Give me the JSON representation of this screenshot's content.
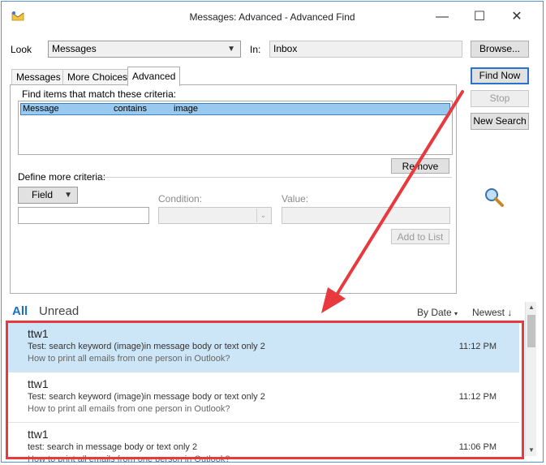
{
  "window": {
    "title": "Messages: Advanced - Advanced Find",
    "minimize_glyph": "—",
    "maximize_glyph": "☐",
    "close_glyph": "✕"
  },
  "look": {
    "label": "Look",
    "value": "Messages",
    "in_label": "In:",
    "in_value": "Inbox",
    "browse_label": "Browse..."
  },
  "actions": {
    "find_now": "Find Now",
    "stop": "Stop",
    "new_search": "New Search"
  },
  "tabs": [
    {
      "label": "Messages"
    },
    {
      "label": "More Choices"
    },
    {
      "label": "Advanced"
    }
  ],
  "advanced": {
    "criteria_heading": "Find items that match these criteria:",
    "criteria": [
      {
        "field": "Message",
        "condition": "contains",
        "value": "image"
      }
    ],
    "remove_label": "Remove",
    "define_heading": "Define more criteria:",
    "field_label": "Field",
    "field_value": "",
    "condition_label": "Condition:",
    "condition_value": "",
    "value_label": "Value:",
    "value_value": "",
    "add_to_list_label": "Add to List"
  },
  "results": {
    "filters": {
      "all": "All",
      "unread": "Unread"
    },
    "sort_by": "By Date",
    "sort_order": "Newest",
    "messages": [
      {
        "sender": "ttw1",
        "subject": "Test: search keyword (image)in message body or text only 2",
        "preview": "How to print all emails from one person in Outlook?",
        "time": "11:12 PM",
        "selected": true
      },
      {
        "sender": "ttw1",
        "subject": "Test: search keyword (image)in message body or text only 2",
        "preview": "How to print all emails from one person in Outlook?",
        "time": "11:12 PM",
        "selected": false
      },
      {
        "sender": "ttw1",
        "subject": "test: search in message body or text only 2",
        "preview": "How to print all emails from one person in Outlook?",
        "time": "11:06 PM",
        "selected": false
      }
    ]
  },
  "colors": {
    "accent": "#2a73cc",
    "selection": "#99c9ef",
    "selected_row": "#cde6f7",
    "annotation": "#e8393e"
  }
}
